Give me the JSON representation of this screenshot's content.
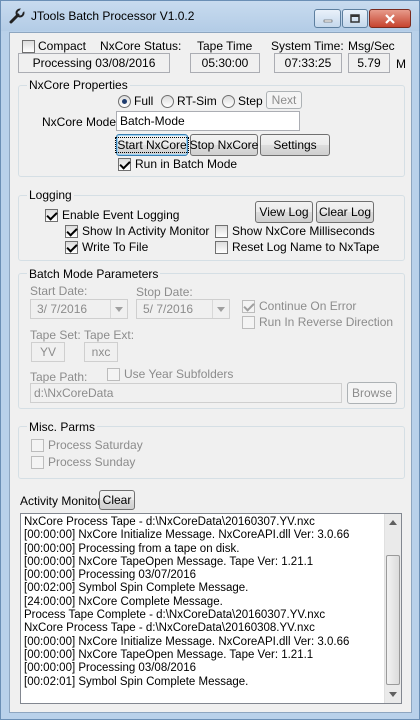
{
  "window": {
    "title": "JTools Batch Processor V1.0.2",
    "icons": {
      "app": "wrench-icon",
      "minimize": "minimize-icon",
      "maximize": "maximize-icon",
      "close": "close-icon"
    }
  },
  "status": {
    "compact_label": "Compact",
    "compact_checked": false,
    "nxcore_status_label": "NxCore Status:",
    "nxcore_status_value": "Processing 03/08/2016",
    "tape_time_label": "Tape Time",
    "tape_time_value": "05:30:00",
    "system_time_label": "System Time:",
    "system_time_value": "07:33:25",
    "msg_sec_label": "Msg/Sec",
    "msg_sec_value": "5.79",
    "msg_sec_unit": "M"
  },
  "nxcore_properties": {
    "group_title": "NxCore Properties",
    "mode_options": [
      "Full",
      "RT-Sim",
      "Step"
    ],
    "selected_mode": "Full",
    "next_label": "Next",
    "mode_label": "NxCore Mode:",
    "mode_value": "Batch-Mode",
    "start_label": "Start NxCore",
    "stop_label": "Stop NxCore",
    "settings_label": "Settings",
    "run_batch_label": "Run in Batch Mode",
    "run_batch_checked": true
  },
  "logging": {
    "group_title": "Logging",
    "enable_label": "Enable Event Logging",
    "enable_checked": true,
    "view_log_label": "View Log",
    "clear_log_label": "Clear Log",
    "show_activity_label": "Show In Activity Monitor",
    "show_activity_checked": true,
    "show_ms_label": "Show NxCore Milliseconds",
    "show_ms_checked": false,
    "write_file_label": "Write To File",
    "write_file_checked": true,
    "reset_log_label": "Reset Log Name to NxTape",
    "reset_log_checked": false
  },
  "batch": {
    "group_title": "Batch Mode Parameters",
    "start_date_label": "Start Date:",
    "start_date_value": "3/  7/2016",
    "stop_date_label": "Stop Date:",
    "stop_date_value": "5/  7/2016",
    "continue_error_label": "Continue On Error",
    "continue_error_checked": true,
    "reverse_label": "Run In Reverse Direction",
    "reverse_checked": false,
    "tape_set_label": "Tape Set:",
    "tape_set_value": "YV",
    "tape_ext_label": "Tape Ext:",
    "tape_ext_value": "nxc",
    "year_sub_label": "Use Year Subfolders",
    "year_sub_checked": false,
    "tape_path_label": "Tape Path:",
    "tape_path_value": "d:\\NxCoreData",
    "browse_label": "Browse"
  },
  "misc": {
    "group_title": "Misc. Parms",
    "saturday_label": "Process Saturday",
    "saturday_checked": false,
    "sunday_label": "Process Sunday",
    "sunday_checked": false
  },
  "activity": {
    "label": "Activity Monitor:",
    "clear_label": "Clear",
    "lines": [
      "NxCore Process Tape - d:\\NxCoreData\\20160307.YV.nxc",
      "[00:00:00] NxCore Initialize Message. NxCoreAPI.dll Ver: 3.0.66",
      "[00:00:00] Processing from a tape on disk.",
      "[00:00:00] NxCore TapeOpen Message. Tape Ver: 1.21.1",
      "[00:00:00] Processing 03/07/2016",
      "[00:02:00] Symbol Spin Complete Message.",
      "[24:00:00] NxCore Complete Message.",
      "Process Tape Complete - d:\\NxCoreData\\20160307.YV.nxc",
      "NxCore Process Tape - d:\\NxCoreData\\20160308.YV.nxc",
      "[00:00:00] NxCore Initialize Message. NxCoreAPI.dll Ver: 3.0.66",
      "[00:00:00] NxCore TapeOpen Message. Tape Ver: 1.21.1",
      "[00:00:00] Processing 03/08/2016",
      "[00:02:01] Symbol Spin Complete Message."
    ]
  }
}
